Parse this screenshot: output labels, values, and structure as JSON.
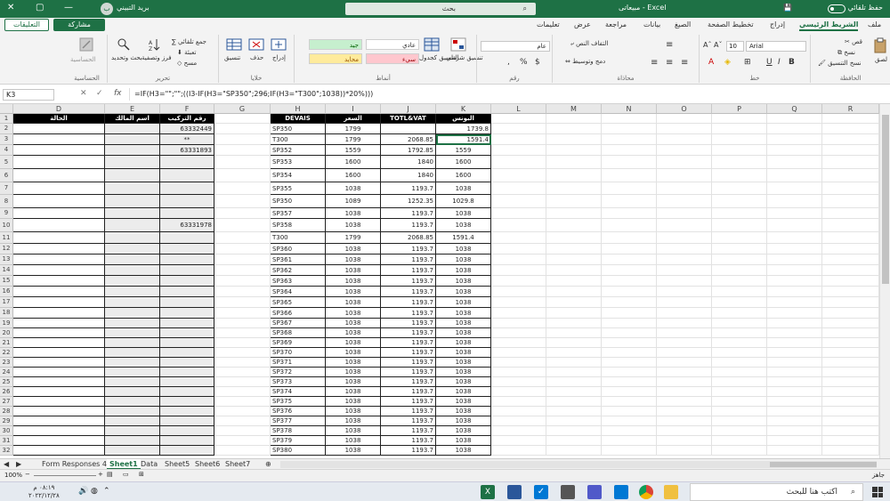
{
  "titlebar": {
    "autosave": "حفظ تلقائي",
    "file_name": "مبيعاتى - Excel",
    "search": "بحث",
    "user": "بريد التبيني",
    "avatar_initials": "ب"
  },
  "menu": {
    "tabs": [
      "ملف",
      "الشريط الرئيسي",
      "إدراج",
      "تخطيط الصفحة",
      "الصيغ",
      "بيانات",
      "مراجعة",
      "عرض",
      "تعليمات"
    ],
    "share": "مشاركة",
    "comments": "التعليقات"
  },
  "ribbon": {
    "clipboard": {
      "label": "الحافظة",
      "paste": "لصق",
      "cut": "قص",
      "copy": "نسخ",
      "format_painter": "نسخ التنسيق"
    },
    "font": {
      "label": "خط",
      "name": "Arial",
      "size": "10",
      "bold": "B",
      "italic": "I",
      "underline": "U"
    },
    "alignment": {
      "label": "محاذاة",
      "wrap": "التفاف النص",
      "merge": "دمج وتوسيط"
    },
    "number": {
      "label": "رقم",
      "format": "عام",
      "percent": "%"
    },
    "styles": {
      "label": "أنماط",
      "conditional": "تنسيق شرطي",
      "as_table": "التنسيق كجدول",
      "normal": "عادي",
      "bad": "سيء",
      "good": "جيد",
      "neutral": "محايد"
    },
    "cells": {
      "label": "خلايا",
      "insert": "إدراج",
      "delete": "حذف",
      "format": "تنسيق"
    },
    "editing": {
      "label": "تحرير",
      "autosum": "جمع تلقائي",
      "fill": "تعبئة",
      "clear": "مسح",
      "sort": "فرز وتصفية",
      "find": "بحث وتحديد"
    },
    "analysis": {
      "label": "الحساسية",
      "btn": "الحساسية"
    }
  },
  "formula_bar": {
    "name_box": "K3",
    "fx": "fx",
    "formula": "=IF(H3=\"\";\"\";((I3-IF(H3=\"SP350\";296;IF(H3=\"T300\";1038))*20%)))"
  },
  "columns": [
    "D",
    "E",
    "F",
    "G",
    "H",
    "I",
    "J",
    "K",
    "L",
    "M",
    "N",
    "O",
    "P",
    "Q",
    "R"
  ],
  "rows": [
    "1",
    "2",
    "3",
    "4",
    "5",
    "6",
    "7",
    "8",
    "9",
    "10",
    "11",
    "12",
    "13",
    "14",
    "15",
    "16",
    "17",
    "18",
    "19",
    "20",
    "21",
    "22",
    "23",
    "24",
    "25",
    "26",
    "27",
    "28",
    "29",
    "30",
    "31",
    "32"
  ],
  "left_table": {
    "headers": [
      "الحالة",
      "اسم المالك",
      "رقم التركيب"
    ],
    "f_values": {
      "2": "63332449",
      "3": "**",
      "4": "63331893",
      "10": "63331978"
    }
  },
  "right_table": {
    "headers": [
      "DEVAIS",
      "السعر",
      "TOTL&VAT",
      "البونس"
    ],
    "rows": [
      [
        "SP350",
        "1799",
        "",
        "1739.8"
      ],
      [
        "T300",
        "1799",
        "2068.85",
        "1591.4"
      ],
      [
        "SP352",
        "1559",
        "1792.85",
        "1559"
      ],
      [
        "SP353",
        "1600",
        "1840",
        "1600"
      ],
      [
        "SP354",
        "1600",
        "1840",
        "1600"
      ],
      [
        "SP355",
        "1038",
        "1193.7",
        "1038"
      ],
      [
        "SP350",
        "1089",
        "1252.35",
        "1029.8"
      ],
      [
        "SP357",
        "1038",
        "1193.7",
        "1038"
      ],
      [
        "SP358",
        "1038",
        "1193.7",
        "1038"
      ],
      [
        "T300",
        "1799",
        "2068.85",
        "1591.4"
      ],
      [
        "SP360",
        "1038",
        "1193.7",
        "1038"
      ],
      [
        "SP361",
        "1038",
        "1193.7",
        "1038"
      ],
      [
        "SP362",
        "1038",
        "1193.7",
        "1038"
      ],
      [
        "SP363",
        "1038",
        "1193.7",
        "1038"
      ],
      [
        "SP364",
        "1038",
        "1193.7",
        "1038"
      ],
      [
        "SP365",
        "1038",
        "1193.7",
        "1038"
      ],
      [
        "SP366",
        "1038",
        "1193.7",
        "1038"
      ],
      [
        "SP367",
        "1038",
        "1193.7",
        "1038"
      ],
      [
        "SP368",
        "1038",
        "1193.7",
        "1038"
      ],
      [
        "SP369",
        "1038",
        "1193.7",
        "1038"
      ],
      [
        "SP370",
        "1038",
        "1193.7",
        "1038"
      ],
      [
        "SP371",
        "1038",
        "1193.7",
        "1038"
      ],
      [
        "SP372",
        "1038",
        "1193.7",
        "1038"
      ],
      [
        "SP373",
        "1038",
        "1193.7",
        "1038"
      ],
      [
        "SP374",
        "1038",
        "1193.7",
        "1038"
      ],
      [
        "SP375",
        "1038",
        "1193.7",
        "1038"
      ],
      [
        "SP376",
        "1038",
        "1193.7",
        "1038"
      ],
      [
        "SP377",
        "1038",
        "1193.7",
        "1038"
      ],
      [
        "SP378",
        "1038",
        "1193.7",
        "1038"
      ],
      [
        "SP379",
        "1038",
        "1193.7",
        "1038"
      ],
      [
        "SP380",
        "1038",
        "1193.7",
        "1038"
      ]
    ]
  },
  "sheet_tabs": [
    "Form Responses 4",
    "Sheet1",
    "Data",
    "Sheet5",
    "Sheet6",
    "Sheet7"
  ],
  "active_sheet": "Sheet1",
  "status": {
    "ready": "جاهز",
    "zoom": "100%"
  },
  "taskbar": {
    "search": "اكتب هنا للبحث",
    "time": "٠٨:١٩ م",
    "date": "٢٠٢٢/١٢/٢٨"
  }
}
